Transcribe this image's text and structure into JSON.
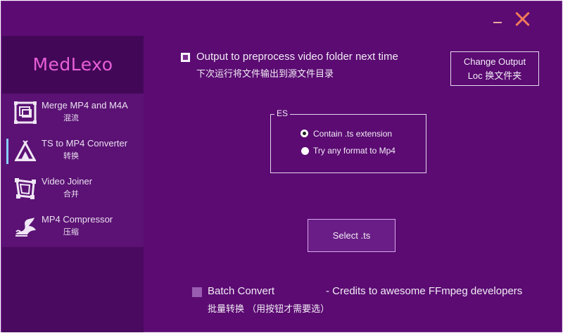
{
  "window": {
    "minimize_icon": "minimize-icon",
    "close_icon": "close-icon"
  },
  "sidebar": {
    "brand": "MedLexo",
    "items": [
      {
        "label": "Merge MP4 and M4A",
        "sub": "混流",
        "icon": "merge-icon",
        "active": false
      },
      {
        "label": "TS to MP4 Converter",
        "sub": "转换",
        "icon": "convert-icon",
        "active": true
      },
      {
        "label": "Video Joiner",
        "sub": "合并",
        "icon": "join-icon",
        "active": false
      },
      {
        "label": "MP4 Compressor",
        "sub": "压缩",
        "icon": "compress-icon",
        "active": false
      }
    ]
  },
  "main": {
    "output_checkbox": {
      "checked": true,
      "label": "Output to preprocess video folder next time",
      "sub": "下次运行将文件输出到源文件目录"
    },
    "change_output_button": {
      "line1": "Change Output",
      "line2": "Loc 换文件夹"
    },
    "es_group": {
      "title": "ES",
      "options": [
        {
          "label": "Contain .ts extension",
          "selected": true
        },
        {
          "label": "Try any format to Mp4",
          "selected": false
        }
      ]
    },
    "select_button": "Select .ts",
    "batch": {
      "checked": false,
      "label": "Batch Convert",
      "credits": "- Credits to awesome FFmpeg developers",
      "sub": "批量转换 （用按钮才需要选）"
    }
  },
  "colors": {
    "background": "#5b0b72",
    "sidebar": "#4a0a5f",
    "brand_text": "#e85fd8",
    "close": "#f07a5a",
    "active_indicator": "#8ad0ff"
  }
}
